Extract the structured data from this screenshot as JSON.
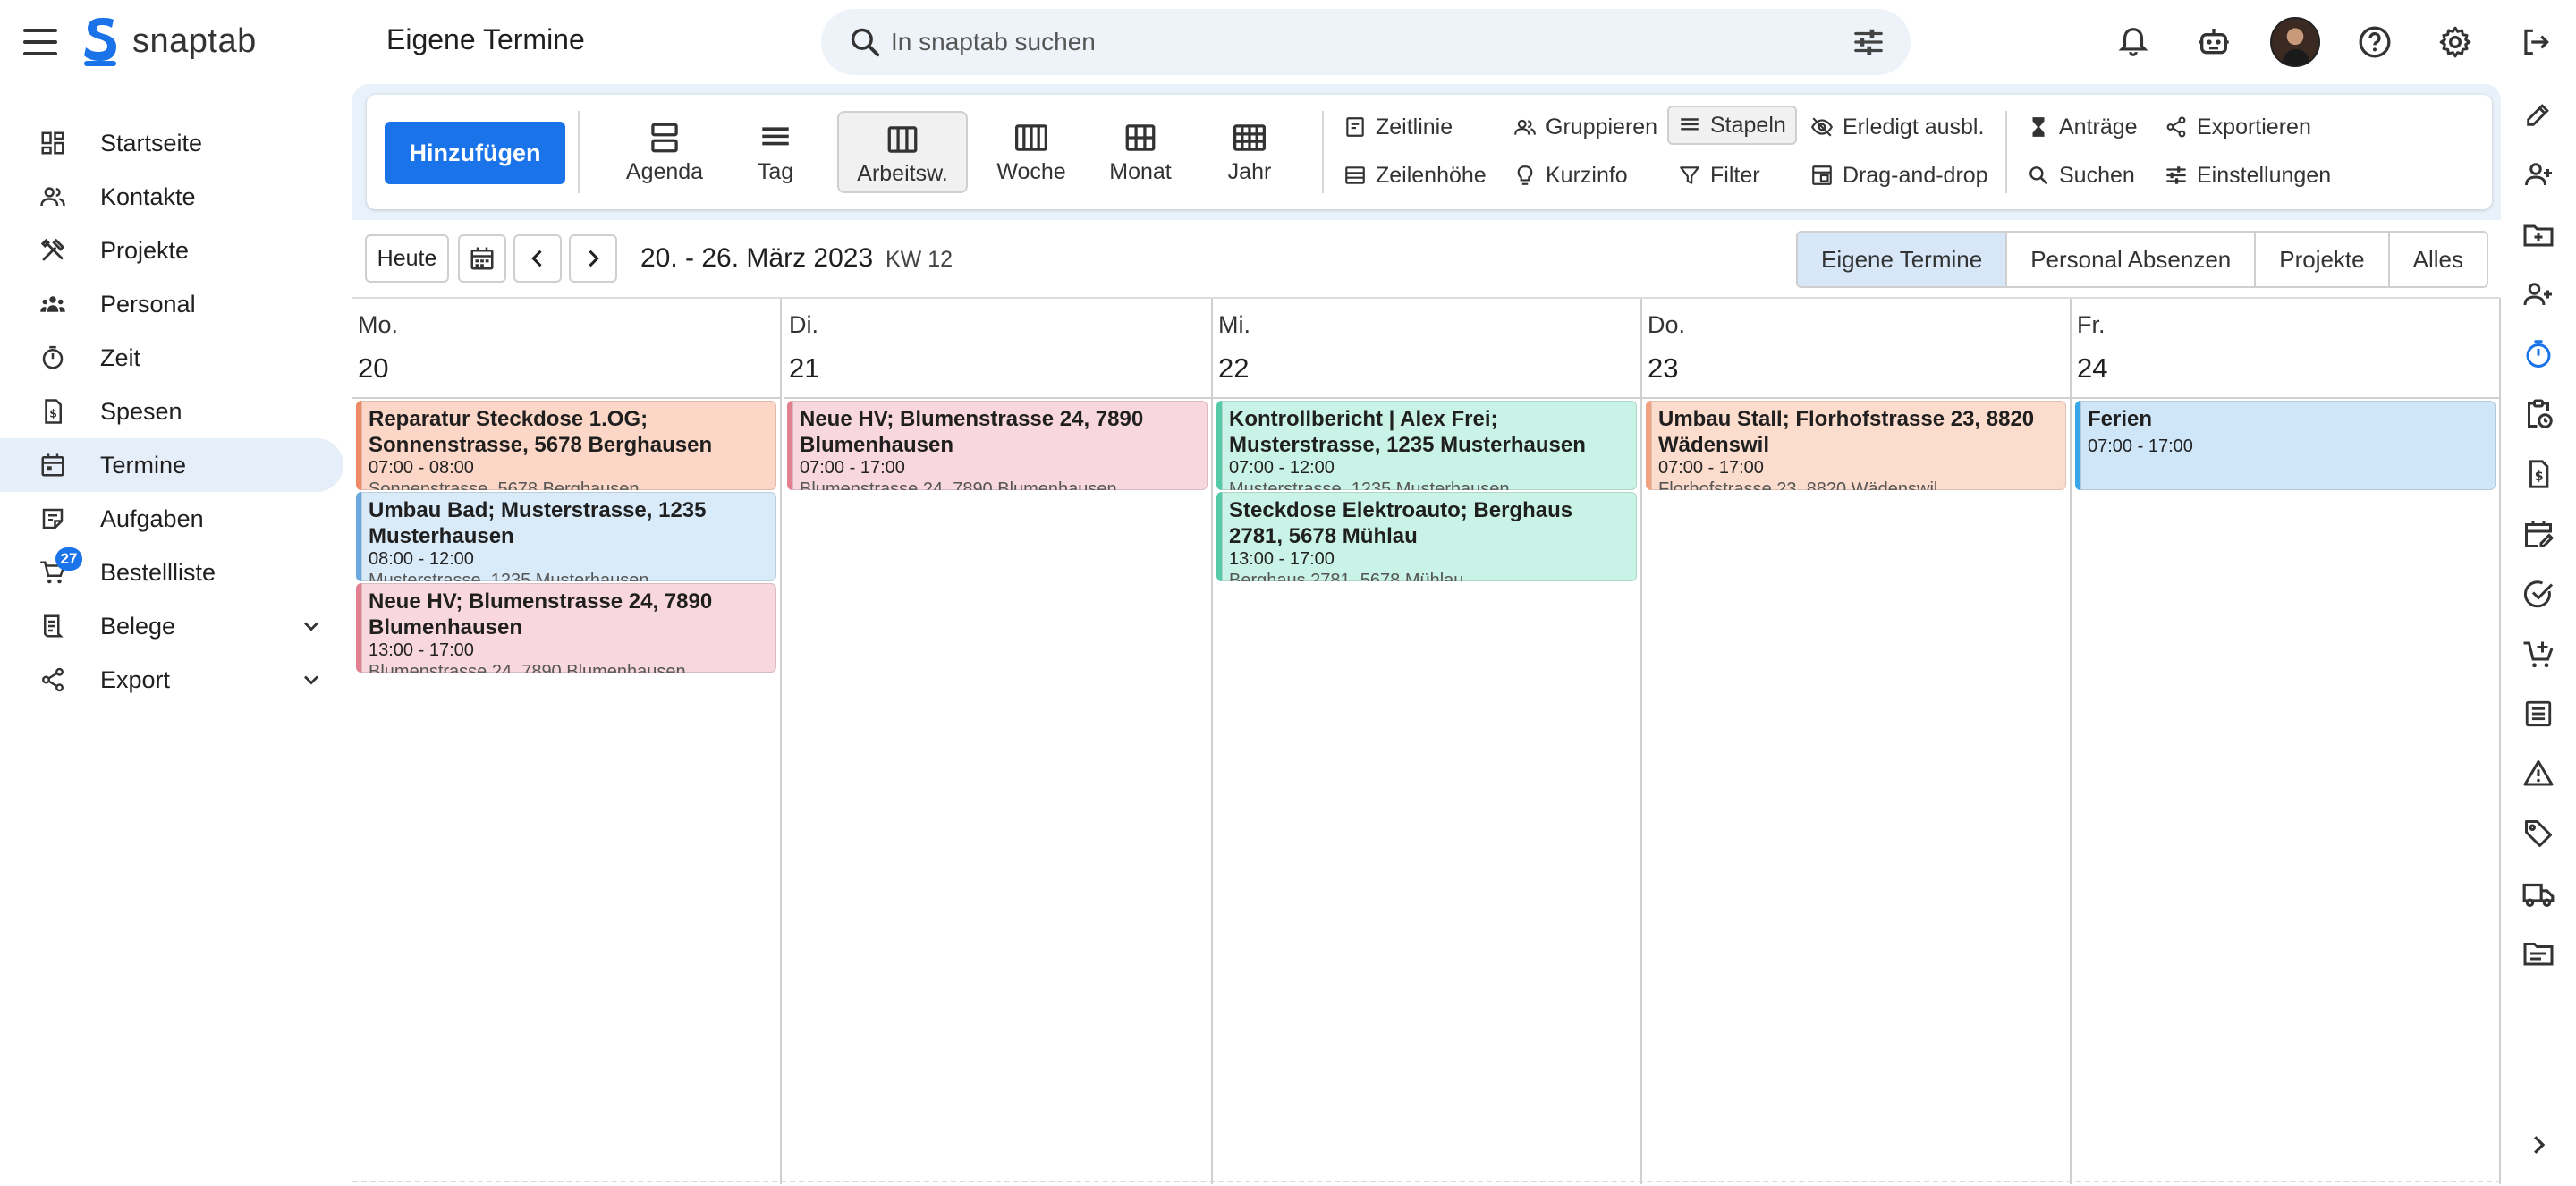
{
  "app": {
    "name": "snaptab",
    "page_title": "Eigene Termine",
    "brand_color": "#1a73e8"
  },
  "search": {
    "placeholder": "In snaptab suchen"
  },
  "topbar_icons": [
    "bell-icon",
    "robot-icon",
    "help-icon",
    "gear-icon",
    "logout-icon"
  ],
  "sidebar": {
    "items": [
      {
        "label": "Startseite",
        "icon": "dashboard-icon",
        "active": false
      },
      {
        "label": "Kontakte",
        "icon": "contacts-icon",
        "active": false
      },
      {
        "label": "Projekte",
        "icon": "tools-icon",
        "active": false
      },
      {
        "label": "Personal",
        "icon": "people-icon",
        "active": false
      },
      {
        "label": "Zeit",
        "icon": "timer-icon",
        "active": false
      },
      {
        "label": "Spesen",
        "icon": "receipt-icon",
        "active": false
      },
      {
        "label": "Termine",
        "icon": "calendar-icon",
        "active": true
      },
      {
        "label": "Aufgaben",
        "icon": "tasks-icon",
        "active": false
      },
      {
        "label": "Bestellliste",
        "icon": "cart-icon",
        "active": false,
        "badge": "27"
      },
      {
        "label": "Belege",
        "icon": "document-icon",
        "active": false,
        "expandable": true
      },
      {
        "label": "Export",
        "icon": "share-icon",
        "active": false,
        "expandable": true
      }
    ]
  },
  "toolbar": {
    "add_label": "Hinzufügen",
    "views": [
      {
        "label": "Agenda",
        "icon": "agenda-icon",
        "active": false
      },
      {
        "label": "Tag",
        "icon": "day-icon",
        "active": false
      },
      {
        "label": "Arbeitsw.",
        "icon": "workweek-icon",
        "active": true
      },
      {
        "label": "Woche",
        "icon": "week-icon",
        "active": false
      },
      {
        "label": "Monat",
        "icon": "month-icon",
        "active": false
      },
      {
        "label": "Jahr",
        "icon": "year-icon",
        "active": false
      }
    ],
    "options": [
      {
        "label": "Zeitlinie",
        "icon": "timeline-icon",
        "active": false
      },
      {
        "label": "Zeilenhöhe",
        "icon": "row-height-icon",
        "active": false
      },
      {
        "label": "Gruppieren",
        "icon": "group-icon",
        "active": false
      },
      {
        "label": "Kurzinfo",
        "icon": "lightbulb-icon",
        "active": false
      },
      {
        "label": "Stapeln",
        "icon": "stack-icon",
        "active": true
      },
      {
        "label": "Filter",
        "icon": "filter-icon",
        "active": false
      },
      {
        "label": "Erledigt ausbl.",
        "icon": "eye-off-icon",
        "active": false
      },
      {
        "label": "Drag-and-drop",
        "icon": "drag-drop-icon",
        "active": false
      },
      {
        "label": "Anträge",
        "icon": "hourglass-icon",
        "active": false
      },
      {
        "label": "Suchen",
        "icon": "search-icon",
        "active": false
      },
      {
        "label": "Exportieren",
        "icon": "share-icon",
        "active": false
      },
      {
        "label": "Einstellungen",
        "icon": "settings-sliders-icon",
        "active": false
      }
    ]
  },
  "datenav": {
    "today_label": "Heute",
    "range": "20. - 26. März 2023",
    "week": "KW 12"
  },
  "filters": [
    {
      "label": "Eigene Termine",
      "active": true
    },
    {
      "label": "Personal Absenzen",
      "active": false
    },
    {
      "label": "Projekte",
      "active": false
    },
    {
      "label": "Alles",
      "active": false
    }
  ],
  "event_colors": {
    "orange": {
      "bg": "#fcd6c6",
      "border": "#ee8a66"
    },
    "blue": {
      "bg": "#d9eaf9",
      "border": "#6aa8e0"
    },
    "pink": {
      "bg": "#f8d7de",
      "border": "#e2808f"
    },
    "teal": {
      "bg": "#c9f3e6",
      "border": "#56c9a6"
    },
    "peach": {
      "bg": "#fcdccd",
      "border": "#f0a283"
    },
    "sky": {
      "bg": "#cfe6f8",
      "border": "#3aa6e8"
    }
  },
  "days": [
    {
      "name": "Mo.",
      "date": "20",
      "events": [
        {
          "title": "Reparatur Steckdose 1.OG; Sonnenstrasse, 5678 Berghausen",
          "time": "07:00 - 08:00",
          "sub": "Sonnenstrasse, 5678 Berghausen",
          "color": "orange"
        },
        {
          "title": "Umbau Bad; Musterstrasse, 1235 Musterhausen",
          "time": "08:00 - 12:00",
          "sub": "Musterstrasse, 1235 Musterhausen",
          "color": "blue"
        },
        {
          "title": "Neue HV; Blumenstrasse 24, 7890 Blumenhausen",
          "time": "13:00 - 17:00",
          "sub": "Blumenstrasse 24, 7890 Blumenhausen",
          "color": "pink"
        }
      ]
    },
    {
      "name": "Di.",
      "date": "21",
      "events": [
        {
          "title": "Neue HV; Blumenstrasse 24, 7890 Blumenhausen",
          "time": "07:00 - 17:00",
          "sub": "Blumenstrasse 24, 7890 Blumenhausen",
          "color": "pink"
        }
      ]
    },
    {
      "name": "Mi.",
      "date": "22",
      "events": [
        {
          "title": "Kontrollbericht | Alex Frei; Musterstrasse, 1235 Musterhausen",
          "time": "07:00 - 12:00",
          "sub": "Musterstrasse, 1235 Musterhausen",
          "color": "teal"
        },
        {
          "title": "Steckdose Elektroauto; Berghaus 2781, 5678 Mühlau",
          "time": "13:00 - 17:00",
          "sub": "Berghaus 2781, 5678 Mühlau",
          "color": "teal"
        }
      ]
    },
    {
      "name": "Do.",
      "date": "23",
      "events": [
        {
          "title": "Umbau Stall; Florhofstrasse 23, 8820 Wädenswil",
          "time": "07:00 - 17:00",
          "sub": "Florhofstrasse 23, 8820 Wädenswil",
          "color": "peach"
        }
      ]
    },
    {
      "name": "Fr.",
      "date": "24",
      "events": [
        {
          "title": "Ferien",
          "time": "07:00 - 17:00",
          "sub": "",
          "color": "sky"
        }
      ]
    }
  ],
  "right_rail_icons": [
    "edit-icon",
    "add-person-icon",
    "new-folder-icon",
    "person-add-icon",
    "timer-icon",
    "clipboard-clock-icon",
    "receipt-icon",
    "calendar-edit-icon",
    "task-done-icon",
    "add-cart-icon",
    "list-icon",
    "warning-icon",
    "tag-icon",
    "truck-icon",
    "folder-icon",
    "chevron-right-icon"
  ]
}
